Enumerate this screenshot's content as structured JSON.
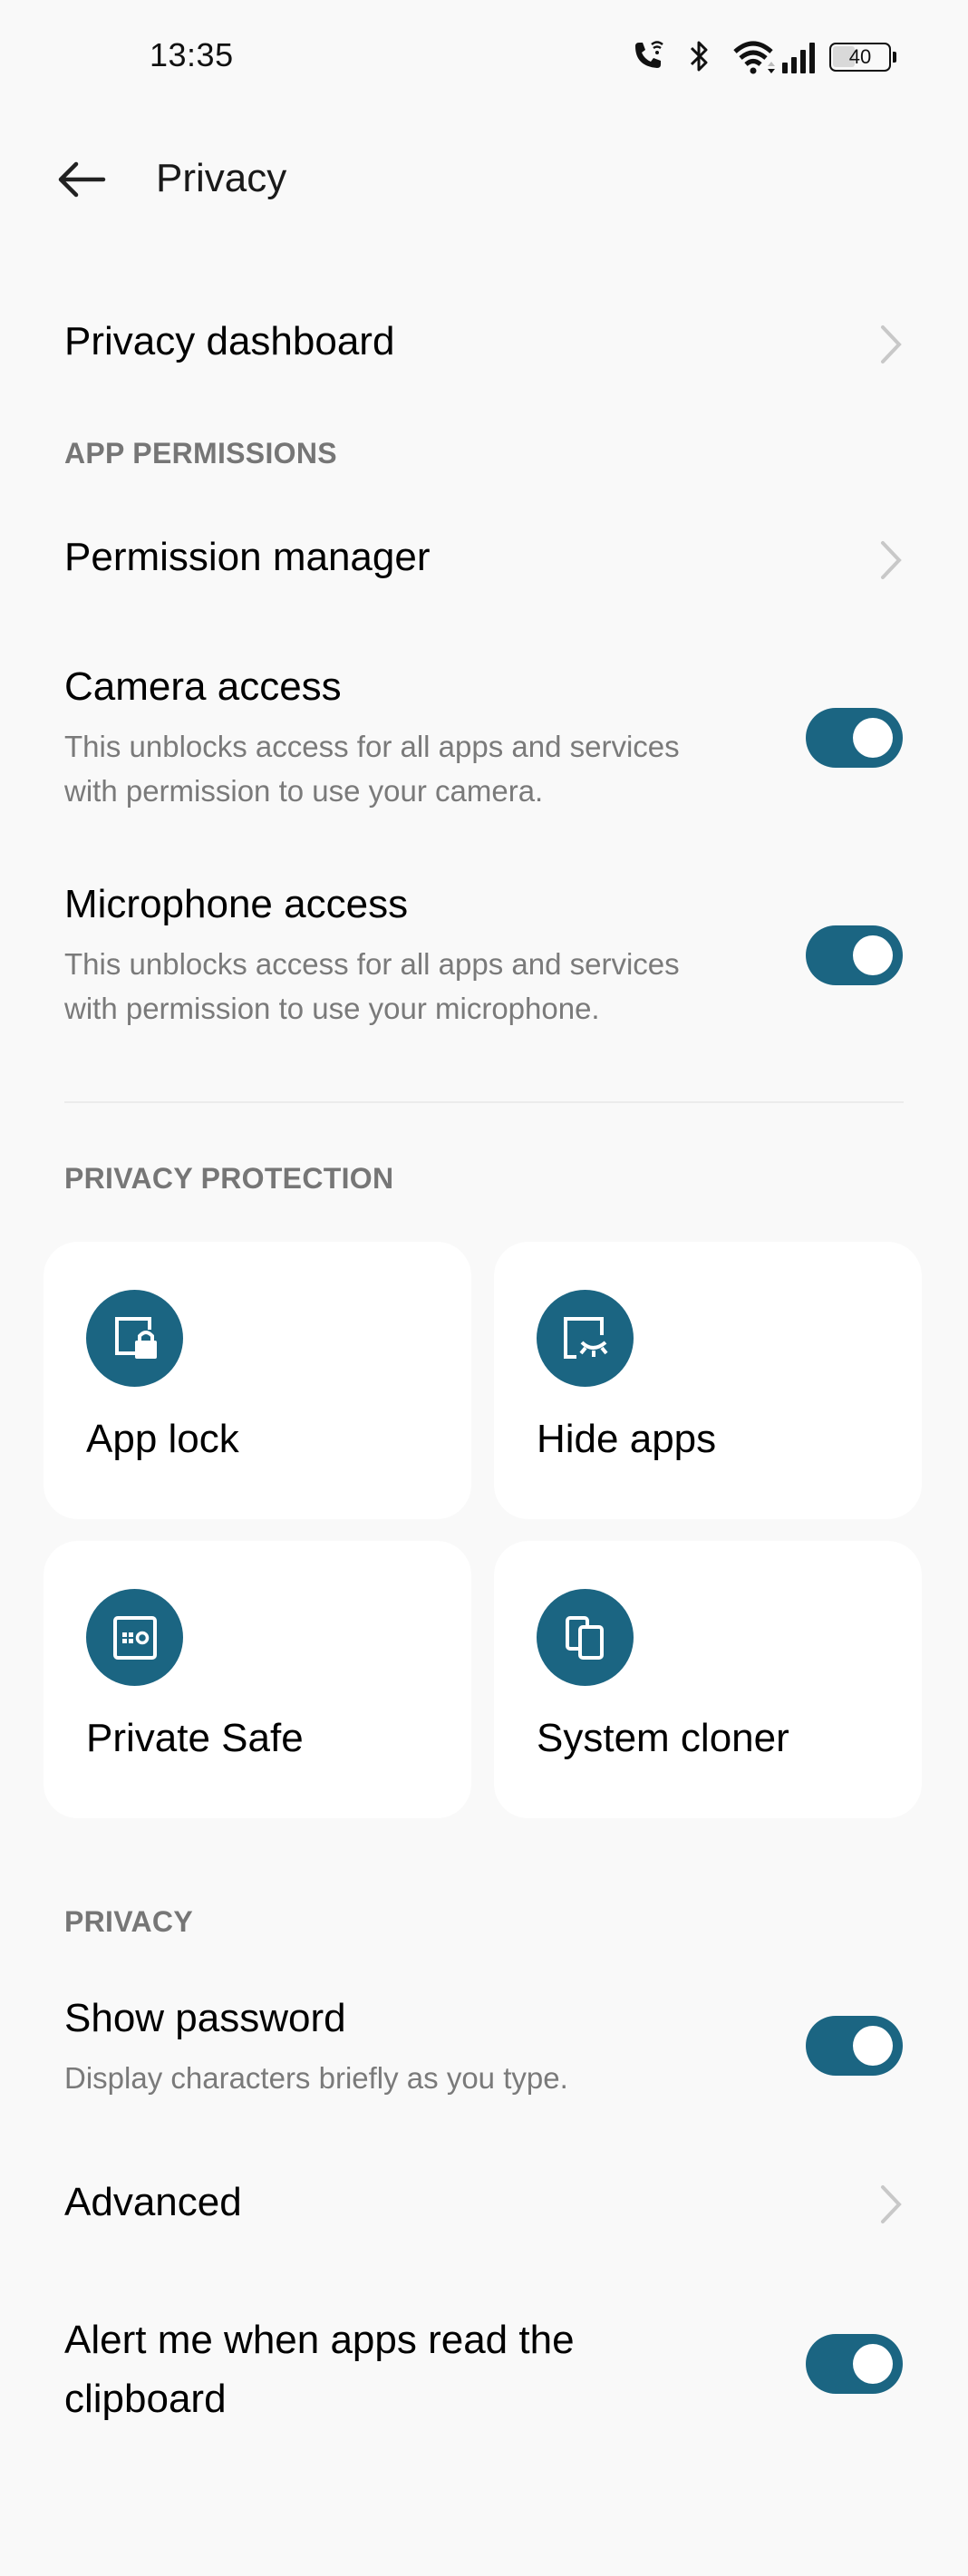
{
  "status_bar": {
    "time": "13:35",
    "battery_level": "40",
    "icons": [
      "wifi-calling-icon",
      "bluetooth-icon",
      "wifi-icon",
      "signal-icon",
      "battery-icon"
    ]
  },
  "header": {
    "title": "Privacy",
    "back_icon": "arrow-left-icon"
  },
  "rows": {
    "privacy_dashboard": {
      "title": "Privacy dashboard"
    },
    "permission_manager": {
      "title": "Permission manager"
    },
    "camera_access": {
      "title": "Camera access",
      "subtitle_line1": "This unblocks access for all apps and services",
      "subtitle_line2": "with permission to use your camera.",
      "enabled": true
    },
    "microphone_access": {
      "title": "Microphone access",
      "subtitle_line1": "This unblocks access for all apps and services",
      "subtitle_line2": "with permission to use your microphone.",
      "enabled": true
    },
    "show_password": {
      "title": "Show password",
      "subtitle": "Display characters briefly as you type.",
      "enabled": true
    },
    "advanced": {
      "title": "Advanced"
    },
    "clipboard_alert": {
      "title_line1": "Alert me when apps read the",
      "title_line2": "clipboard",
      "enabled": true
    }
  },
  "sections": {
    "app_permissions": "APP PERMISSIONS",
    "privacy_protection": "PRIVACY PROTECTION",
    "privacy": "PRIVACY"
  },
  "protection_cards": [
    {
      "label": "App lock",
      "icon": "app-lock-icon"
    },
    {
      "label": "Hide apps",
      "icon": "hide-apps-icon"
    },
    {
      "label": "Private Safe",
      "icon": "private-safe-icon"
    },
    {
      "label": "System cloner",
      "icon": "system-cloner-icon"
    }
  ],
  "colors": {
    "accent": "#1b6582",
    "background": "#f9f9f9",
    "card": "#ffffff",
    "section_label": "#767676",
    "subtitle": "#7a7a7a",
    "chevron": "#c8c8c8"
  }
}
